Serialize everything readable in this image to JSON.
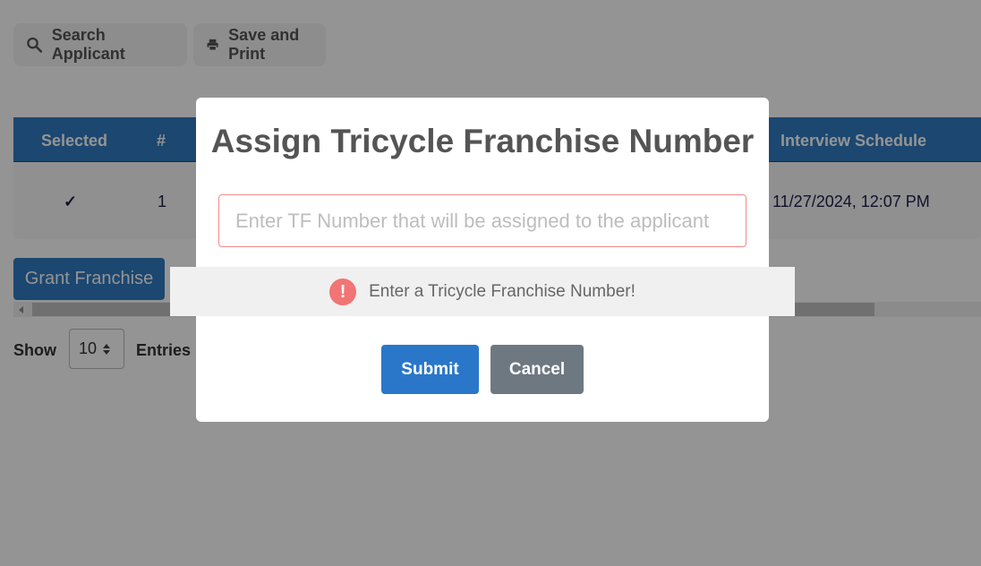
{
  "toolbar": {
    "search_label": "Search Applicant",
    "print_label": "Save and Print"
  },
  "table": {
    "headers": [
      "Selected",
      "#",
      "Interview Schedule"
    ],
    "row": {
      "selected": "✓",
      "number": "1",
      "interview_schedule": "11/27/2024, 12:07 PM"
    }
  },
  "grant_button": "Grant Franchise",
  "pagination": {
    "show_label": "Show",
    "entries_value": "10",
    "entries_label": "Entries"
  },
  "modal": {
    "title": "Assign Tricycle Franchise Number",
    "input_placeholder": "Enter TF Number that will be assigned to the applicant",
    "input_value": "",
    "validation_icon": "!",
    "validation_message": "Enter a Tricycle Franchise Number!",
    "submit_label": "Submit",
    "cancel_label": "Cancel"
  },
  "colors": {
    "primary": "#2a77c9",
    "cancel": "#6e7881",
    "warning": "#f27474"
  }
}
